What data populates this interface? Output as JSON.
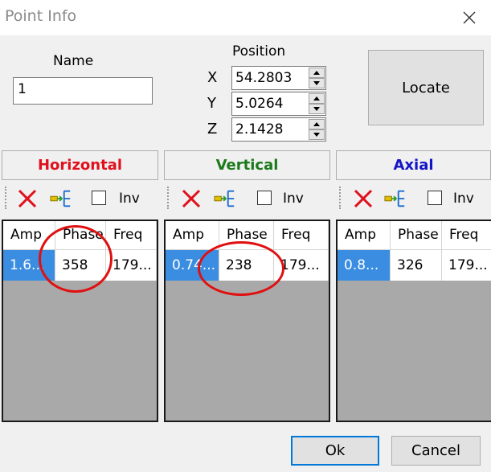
{
  "window": {
    "title": "Point Info"
  },
  "name_field": {
    "label": "Name",
    "value": "1"
  },
  "position": {
    "label": "Position",
    "x": {
      "label": "X",
      "value": "54.2803"
    },
    "y": {
      "label": "Y",
      "value": "5.0264"
    },
    "z": {
      "label": "Z",
      "value": "2.1428"
    }
  },
  "buttons": {
    "locate": "Locate",
    "ok": "Ok",
    "cancel": "Cancel"
  },
  "colors": {
    "horizontal": "#e0101c",
    "vertical": "#1a7a1a",
    "axial": "#1414c8",
    "annotation": "#e01010",
    "selection": "#3a8de0"
  },
  "panels": [
    {
      "title": "Horizontal",
      "inv_label": "Inv",
      "columns": [
        "Amp",
        "Phase",
        "Freq"
      ],
      "row": {
        "amp": "1.6...",
        "phase": "358",
        "freq": "179..."
      }
    },
    {
      "title": "Vertical",
      "inv_label": "Inv",
      "columns": [
        "Amp",
        "Phase",
        "Freq"
      ],
      "row": {
        "amp": "0.74...",
        "phase": "238",
        "freq": "179..."
      }
    },
    {
      "title": "Axial",
      "inv_label": "Inv",
      "columns": [
        "Amp",
        "Phase",
        "Freq"
      ],
      "row": {
        "amp": "0.8...",
        "phase": "326",
        "freq": "179..."
      }
    }
  ],
  "icons": {
    "delete": "red-x-icon",
    "add": "add-column-icon",
    "close": "close-icon"
  }
}
